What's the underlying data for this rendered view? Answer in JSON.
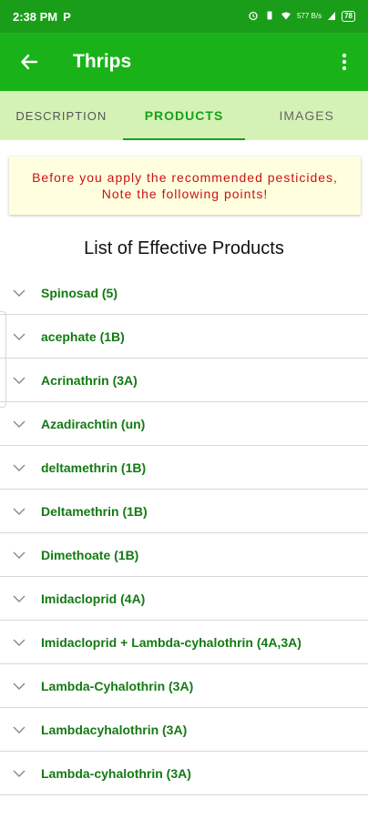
{
  "status_bar": {
    "time": "2:38 PM",
    "carrier_icon": "P",
    "network_speed": "577 B/s",
    "battery": "78"
  },
  "app_bar": {
    "title": "Thrips",
    "back_icon": "arrow-left-icon",
    "menu_icon": "more-vert-icon"
  },
  "tabs": [
    {
      "label": "DESCRIPTION"
    },
    {
      "label": "PRODUCTS"
    },
    {
      "label": "IMAGES"
    }
  ],
  "notice": {
    "text": "Before you apply the recommended pesticides, Note the following points!"
  },
  "list_title": "List of Effective Products",
  "products": [
    "Spinosad (5)",
    "acephate (1B)",
    "Acrinathrin (3A)",
    "Azadirachtin (un)",
    "deltamethrin (1B)",
    "Deltamethrin (1B)",
    "Dimethoate (1B)",
    "Imidacloprid (4A)",
    "Imidacloprid + Lambda-cyhalothrin (4A,3A)",
    "Lambda-Cyhalothrin (3A)",
    "Lambdacyhalothrin (3A)",
    "Lambda-cyhalothrin (3A)"
  ],
  "colors": {
    "status_bar": "#1a9e1a",
    "app_bar": "#19b319",
    "tabs_bg": "#d5f2b6",
    "product_text": "#137a13",
    "notice_text": "#cc1111"
  }
}
